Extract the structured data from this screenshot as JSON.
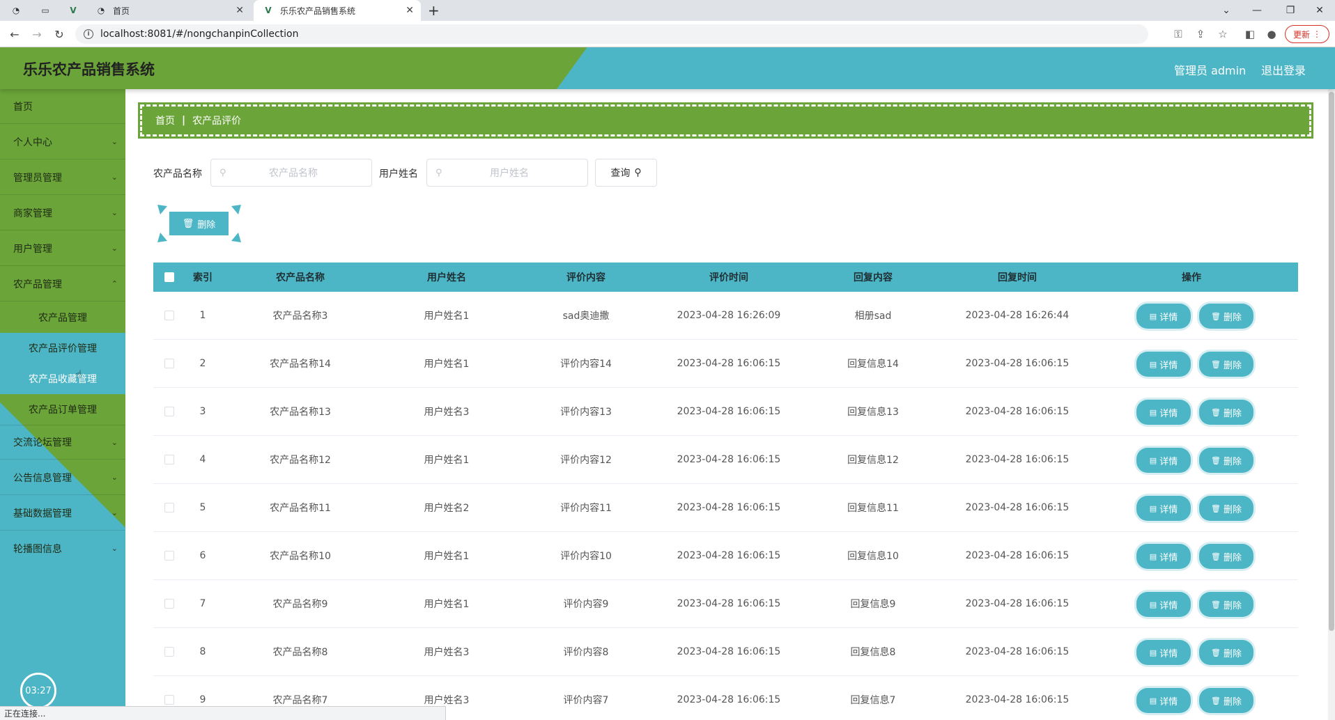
{
  "browser": {
    "tabs": [
      {
        "label": "",
        "icon": "globe-icon"
      },
      {
        "label": "",
        "icon": "blank-page-icon"
      },
      {
        "label": "",
        "icon": "vue-logo-icon"
      },
      {
        "label": "首页",
        "icon": "globe-icon"
      },
      {
        "label": "乐乐农产品销售系统",
        "icon": "vue-logo-icon"
      }
    ],
    "url": "localhost:8081/#/nongchanpinCollection",
    "update_label": "更新",
    "status_text": "正在连接..."
  },
  "header": {
    "title": "乐乐农产品销售系统",
    "user_label": "管理员 admin",
    "logout_label": "退出登录"
  },
  "sidebar": {
    "items": [
      {
        "label": "首页",
        "has_children": false
      },
      {
        "label": "个人中心",
        "has_children": true
      },
      {
        "label": "管理员管理",
        "has_children": true
      },
      {
        "label": "商家管理",
        "has_children": true
      },
      {
        "label": "用户管理",
        "has_children": true
      },
      {
        "label": "农产品管理",
        "has_children": true
      },
      {
        "label": "交流论坛管理",
        "has_children": true
      },
      {
        "label": "公告信息管理",
        "has_children": true
      },
      {
        "label": "基础数据管理",
        "has_children": true
      },
      {
        "label": "轮播图信息",
        "has_children": true
      }
    ],
    "submenu": [
      {
        "label": "农产品管理"
      },
      {
        "label": "农产品评价管理"
      },
      {
        "label": "农产品收藏管理"
      },
      {
        "label": "农产品订单管理"
      }
    ],
    "clock": "03:27"
  },
  "breadcrumb": {
    "home": "首页",
    "current": "农产品评价"
  },
  "search": {
    "product_label": "农产品名称",
    "product_placeholder": "农产品名称",
    "user_label": "用户姓名",
    "user_placeholder": "用户姓名",
    "query_label": "查询"
  },
  "toolbar": {
    "delete_label": "删除"
  },
  "table": {
    "columns": [
      "索引",
      "农产品名称",
      "用户姓名",
      "评价内容",
      "评价时间",
      "回复内容",
      "回复时间",
      "操作"
    ],
    "detail_label": "详情",
    "delete_label": "删除",
    "rows": [
      {
        "index": "1",
        "product": "农产品名称3",
        "user": "用户姓名1",
        "content": "sad奥迪撒",
        "time": "2023-04-28 16:26:09",
        "reply": "相册sad",
        "reply_time": "2023-04-28 16:26:44"
      },
      {
        "index": "2",
        "product": "农产品名称14",
        "user": "用户姓名1",
        "content": "评价内容14",
        "time": "2023-04-28 16:06:15",
        "reply": "回复信息14",
        "reply_time": "2023-04-28 16:06:15"
      },
      {
        "index": "3",
        "product": "农产品名称13",
        "user": "用户姓名3",
        "content": "评价内容13",
        "time": "2023-04-28 16:06:15",
        "reply": "回复信息13",
        "reply_time": "2023-04-28 16:06:15"
      },
      {
        "index": "4",
        "product": "农产品名称12",
        "user": "用户姓名1",
        "content": "评价内容12",
        "time": "2023-04-28 16:06:15",
        "reply": "回复信息12",
        "reply_time": "2023-04-28 16:06:15"
      },
      {
        "index": "5",
        "product": "农产品名称11",
        "user": "用户姓名2",
        "content": "评价内容11",
        "time": "2023-04-28 16:06:15",
        "reply": "回复信息11",
        "reply_time": "2023-04-28 16:06:15"
      },
      {
        "index": "6",
        "product": "农产品名称10",
        "user": "用户姓名1",
        "content": "评价内容10",
        "time": "2023-04-28 16:06:15",
        "reply": "回复信息10",
        "reply_time": "2023-04-28 16:06:15"
      },
      {
        "index": "7",
        "product": "农产品名称9",
        "user": "用户姓名1",
        "content": "评价内容9",
        "time": "2023-04-28 16:06:15",
        "reply": "回复信息9",
        "reply_time": "2023-04-28 16:06:15"
      },
      {
        "index": "8",
        "product": "农产品名称8",
        "user": "用户姓名3",
        "content": "评价内容8",
        "time": "2023-04-28 16:06:15",
        "reply": "回复信息8",
        "reply_time": "2023-04-28 16:06:15"
      },
      {
        "index": "9",
        "product": "农产品名称7",
        "user": "用户姓名3",
        "content": "评价内容7",
        "time": "2023-04-28 16:06:15",
        "reply": "回复信息7",
        "reply_time": "2023-04-28 16:06:15"
      }
    ]
  },
  "colors": {
    "green": "#6ba539",
    "teal": "#4db6c6"
  }
}
